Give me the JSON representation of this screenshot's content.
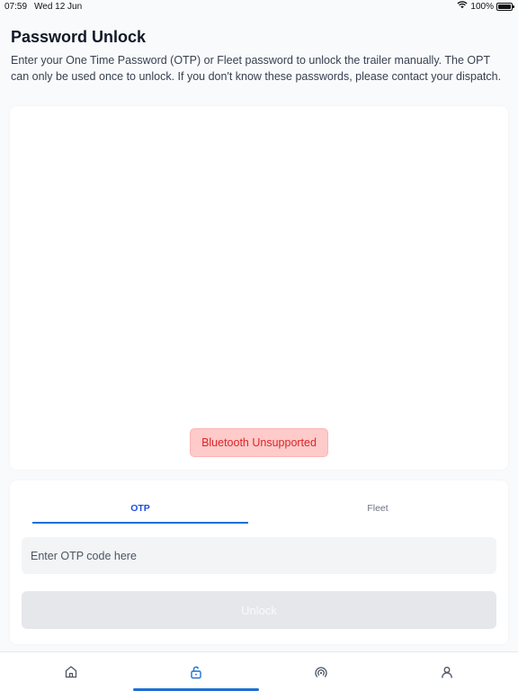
{
  "status_bar": {
    "time": "07:59",
    "date": "Wed 12 Jun",
    "battery_text": "100%",
    "battery_level": 1.0,
    "wifi_icon": "wifi-icon",
    "battery_icon": "battery-icon"
  },
  "header": {
    "title": "Password Unlock",
    "description": "Enter your One Time Password (OTP) or Fleet password to unlock the trailer manually. The OPT can only be used once to unlock. If you don't know these passwords, please contact your dispatch."
  },
  "scanner": {
    "status_badge": "Bluetooth Unsupported"
  },
  "password_form": {
    "tabs": [
      {
        "label": "OTP",
        "active": true
      },
      {
        "label": "Fleet",
        "active": false
      }
    ],
    "otp_input": {
      "value": "",
      "placeholder": "Enter OTP code here"
    },
    "unlock_label": "Unlock",
    "unlock_disabled": true
  },
  "bottom_nav": {
    "items": [
      {
        "icon": "home-icon",
        "active": false
      },
      {
        "icon": "unlock-icon",
        "active": true
      },
      {
        "icon": "signal-icon",
        "active": false
      },
      {
        "icon": "profile-icon",
        "active": false
      }
    ]
  },
  "colors": {
    "accent": "#1d6fd6",
    "error_bg": "#fecaca",
    "error_text": "#dc2626",
    "page_bg": "#f9fafb"
  }
}
